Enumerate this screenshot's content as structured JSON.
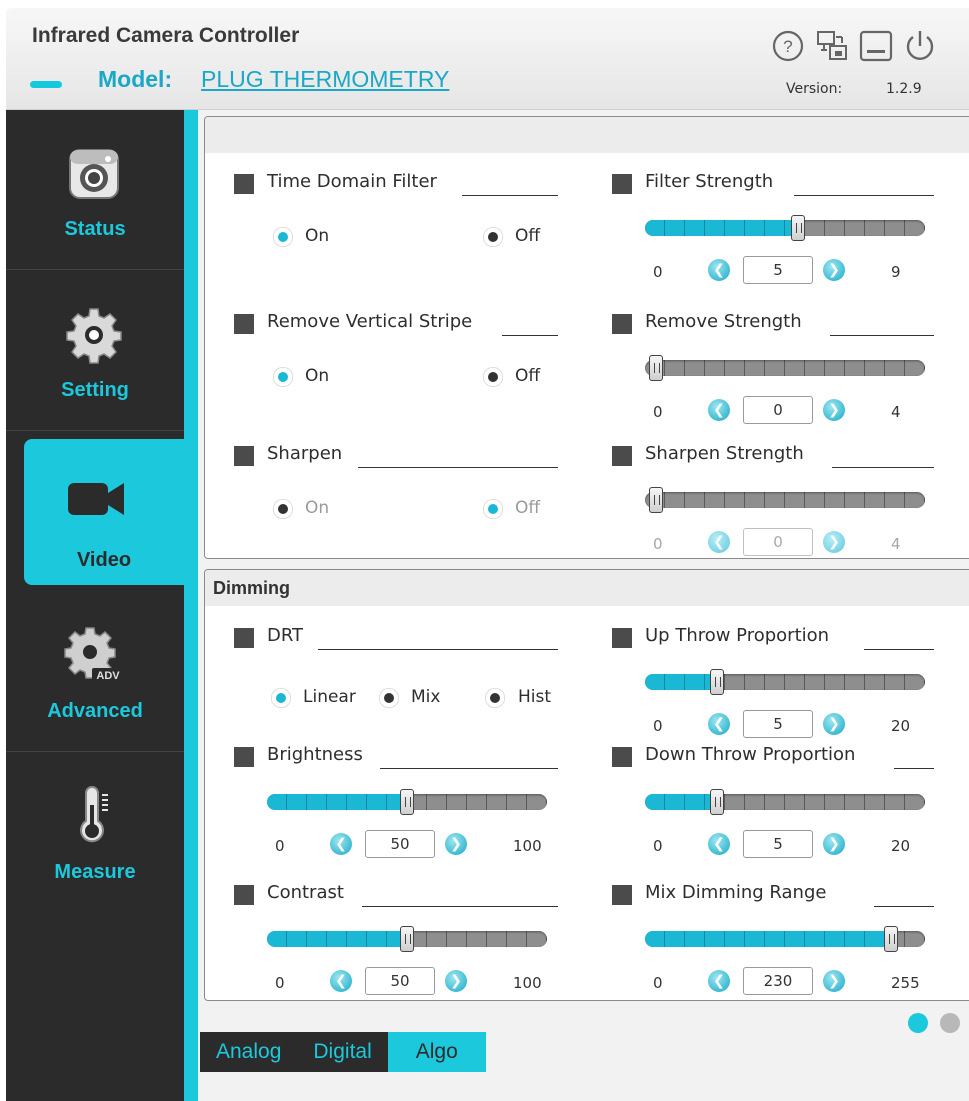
{
  "app": {
    "title": "Infrared Camera Controller"
  },
  "header": {
    "model_label": "Model:",
    "model_value": "PLUG THERMOMETRY",
    "version_label": "Version:",
    "version_value": "1.2.9",
    "icons": [
      "help-icon",
      "display-settings-icon",
      "minimize-icon",
      "power-icon"
    ]
  },
  "sidebar": {
    "items": [
      {
        "label": "Status",
        "icon": "camera-icon"
      },
      {
        "label": "Setting",
        "icon": "gear-icon"
      },
      {
        "label": "Video",
        "icon": "video-camera-icon",
        "active": true
      },
      {
        "label": "Advanced",
        "icon": "advanced-gear-icon"
      },
      {
        "label": "Measure",
        "icon": "thermometer-icon"
      }
    ]
  },
  "filter_panel": {
    "time_domain": {
      "label": "Time Domain Filter",
      "options": [
        "On",
        "Off"
      ],
      "selected": "On",
      "strength_label": "Filter Strength",
      "min": "0",
      "max": "9",
      "value": "5",
      "level": 5
    },
    "vertical_stripe": {
      "label": "Remove Vertical Stripe",
      "options": [
        "On",
        "Off"
      ],
      "selected": "On",
      "strength_label": "Remove Strength",
      "min": "0",
      "max": "4",
      "value": "0",
      "level": 0
    },
    "sharpen": {
      "label": "Sharpen",
      "options": [
        "On",
        "Off"
      ],
      "selected": "Off",
      "strength_label": "Sharpen Strength",
      "min": "0",
      "max": "4",
      "value": "0",
      "level": 0
    }
  },
  "dimming_panel": {
    "title": "Dimming",
    "drt": {
      "label": "DRT",
      "options": [
        "Linear",
        "Mix",
        "Hist"
      ],
      "selected": "Linear"
    },
    "brightness": {
      "label": "Brightness",
      "min": "0",
      "max": "100",
      "value": "50",
      "level": 50
    },
    "contrast": {
      "label": "Contrast",
      "min": "0",
      "max": "100",
      "value": "50",
      "level": 50
    },
    "up_throw": {
      "label": "Up Throw Proportion",
      "min": "0",
      "max": "20",
      "value": "5",
      "level": 5
    },
    "down_throw": {
      "label": "Down Throw Proportion",
      "min": "0",
      "max": "20",
      "value": "5",
      "level": 5
    },
    "mix_range": {
      "label": "Mix Dimming Range",
      "min": "0",
      "max": "255",
      "value": "230",
      "level": 230
    }
  },
  "colors": {
    "accent": "#1cc8dc",
    "sidebar_bg": "#2b2b2b"
  },
  "pagination": {
    "pages": 2,
    "current": 1
  },
  "bottom_tabs": [
    {
      "label": "Analog"
    },
    {
      "label": "Digital"
    },
    {
      "label": "Algo",
      "active": true
    }
  ]
}
